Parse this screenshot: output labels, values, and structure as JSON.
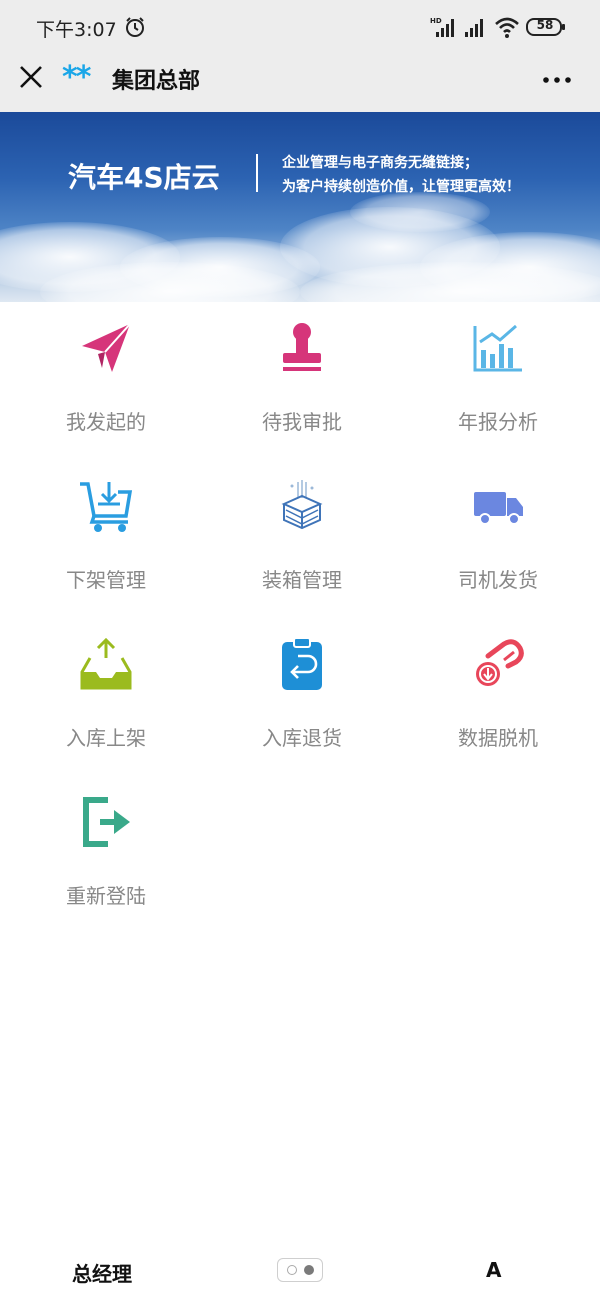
{
  "status_bar": {
    "time": "下午3:07",
    "battery": "58",
    "icons": [
      "alarm-icon",
      "hd-signal-icon",
      "signal-icon",
      "wifi-icon",
      "battery-icon"
    ]
  },
  "nav": {
    "stars": "**",
    "title": "集团总部",
    "close_icon": "close-icon",
    "more_icon": "more-icon"
  },
  "banner": {
    "title": "汽车4S店云",
    "line1": "企业管理与电子商务无缝链接；",
    "line2": "为客户持续创造价值，让管理更高效！"
  },
  "menu": [
    {
      "label": "我发起的",
      "icon": "paper-plane-icon",
      "color": "#d6357a"
    },
    {
      "label": "待我审批",
      "icon": "stamp-icon",
      "color": "#d6357a"
    },
    {
      "label": "年报分析",
      "icon": "bar-chart-icon",
      "color": "#5ab6e6"
    },
    {
      "label": "下架管理",
      "icon": "shopping-cart-icon",
      "color": "#2a9de0"
    },
    {
      "label": "装箱管理",
      "icon": "packing-box-icon",
      "color": "#3f74b8"
    },
    {
      "label": "司机发货",
      "icon": "delivery-truck-icon",
      "color": "#6b87e0"
    },
    {
      "label": "入库上架",
      "icon": "inbox-upload-icon",
      "color": "#9bbb1e"
    },
    {
      "label": "入库退货",
      "icon": "clipboard-return-icon",
      "color": "#1e8fd6"
    },
    {
      "label": "数据脱机",
      "icon": "data-offline-icon",
      "color": "#e8465a"
    },
    {
      "label": "重新登陆",
      "icon": "logout-icon",
      "color": "#3aa98a"
    }
  ],
  "bottom_bar": {
    "left_label": "总经理",
    "right_label": "A"
  }
}
